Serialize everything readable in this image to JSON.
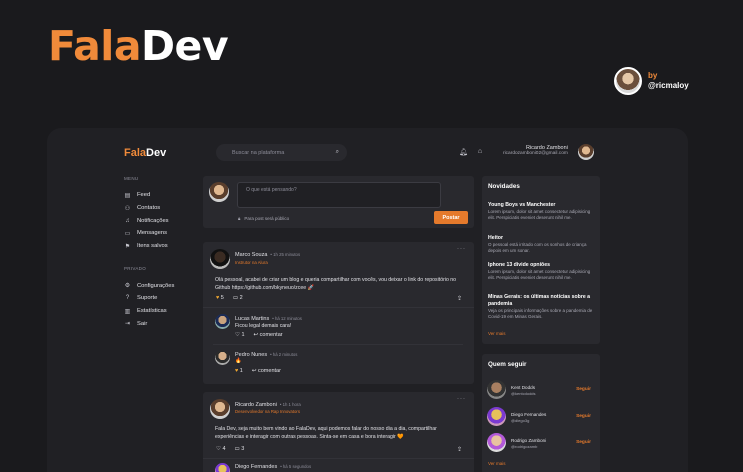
{
  "brand": {
    "part1": "Fala",
    "part2": "Dev"
  },
  "author": {
    "by": "by",
    "handle": "@ricmaloy"
  },
  "app": {
    "logo1": "Fala",
    "logo2": "Dev",
    "search_placeholder": "Buscar na plataforma",
    "user": {
      "name": "Ricardo Zamboni",
      "email": "ricardozamboni02@gmail.com"
    },
    "menu_label": "MENU",
    "menu": [
      "Feed",
      "Contatos",
      "Notificações",
      "Mensagens",
      "Itens salvos"
    ],
    "privacy_label": "PRIVADO",
    "privacy": [
      "Configurações",
      "Suporte",
      "Estatísticas",
      "Sair"
    ],
    "composer": {
      "placeholder": "O que está pensando?",
      "public": "Para post será público",
      "button": "Postar"
    },
    "post1": {
      "name": "Marco Souza",
      "time": "• 1h 25 minutos",
      "role": "Instrutor na Alura",
      "text": "Olá pessoal, acabei de criar um blog e queria compartilhar com vocês, vou deixar o link do repositório no Github https://github.com/bkyneuo/zcee 🚀",
      "likes": "5",
      "comments": "2",
      "comment1": {
        "name": "Lucas Martins",
        "time": "• há 12 minutos",
        "text": "Ficou legal demais cara!",
        "likes": "1",
        "action": "comentar"
      },
      "comment2": {
        "name": "Pedro Nunes",
        "time": "• há 2 minutos",
        "text": "🔥",
        "likes": "1",
        "action": "comentar"
      }
    },
    "post2": {
      "name": "Ricardo Zamboni",
      "time": "• 1h 1 hora",
      "role": "Desenvolvedor na Rap Innovators",
      "text": "Fala Dev, seja muito bem vindo ao FalaDev, aqui podemos falar do nosso dia a dia, compartilhar experiências e interagir com outras pessoas. Sinta-se em casa e bora interagir 🧡",
      "likes": "4",
      "comments": "3",
      "reply_name": "Diego Fernandes",
      "reply_time": "• há 5 segundos"
    },
    "news": {
      "title": "Novidades",
      "items": [
        {
          "t": "Young Boys vs Manchester",
          "d": "Lorem ipsum, dolor sit amet consectetur adipisicing elit. Perspiciatis eveniet deserunt nihil me."
        },
        {
          "t": "Heitor",
          "d": "O pessoal está irritado com os sonhos de criança depois em um sonar."
        },
        {
          "t": "Iphone 13 divide opniões",
          "d": "Lorem ipsum, dolor sit amet consectetur adipisicing elit. Perspiciatis eveniet deserunt nihil me."
        },
        {
          "t": "Minas Gerais: os últimas notícias sobre a pandemia",
          "d": "Veja os principais informações sobre a pandemia de Covid-19 em Minas Gerais."
        }
      ],
      "more": "Ver mais"
    },
    "follow": {
      "title": "Quem seguir",
      "items": [
        {
          "n": "Kent Dodds",
          "h": "@kentcdodds",
          "f": "Seguir"
        },
        {
          "n": "Diego Fernandes",
          "h": "@diego3g",
          "f": "Seguir"
        },
        {
          "n": "Rodrigo Zamboni",
          "h": "@rodrigozamb",
          "f": "Seguir"
        }
      ],
      "more": "Ver mais"
    }
  }
}
